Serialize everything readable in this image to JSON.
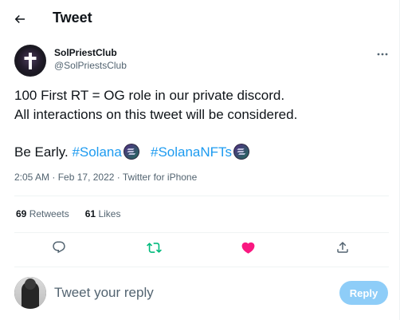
{
  "header": {
    "title": "Tweet",
    "back_icon": "arrow-left-icon"
  },
  "author": {
    "name": "SolPriestClub",
    "handle": "@SolPriestsClub",
    "avatar": "priest-cross-avatar",
    "more_icon": "more-dots-icon"
  },
  "tweet": {
    "line1": "100 First RT = OG role in our private discord.",
    "line2": "All interactions on this tweet will be considered.",
    "line3_prefix": "Be Early. ",
    "hashtag1": "#Solana",
    "hashtag2": "#SolanaNFTs",
    "hashtag_emoji": "solana-logo-icon",
    "colors": {
      "text": "#0f1419",
      "link": "#1d9bf0",
      "muted": "#536471"
    }
  },
  "meta": {
    "time": "2:05 AM",
    "date": "Feb 17, 2022",
    "separator": " · ",
    "source": "Twitter for iPhone"
  },
  "stats": {
    "retweets_count": "69",
    "retweets_label": "Retweets",
    "likes_count": "61",
    "likes_label": "Likes"
  },
  "actions": {
    "reply_icon": "reply-bubble-icon",
    "retweet_icon": "retweet-icon",
    "retweet_color": "#00ba7c",
    "like_icon": "heart-icon",
    "like_color": "#f91880",
    "share_icon": "share-icon"
  },
  "composer": {
    "placeholder": "Tweet your reply",
    "button_label": "Reply",
    "button_color": "#8ecdf8"
  }
}
